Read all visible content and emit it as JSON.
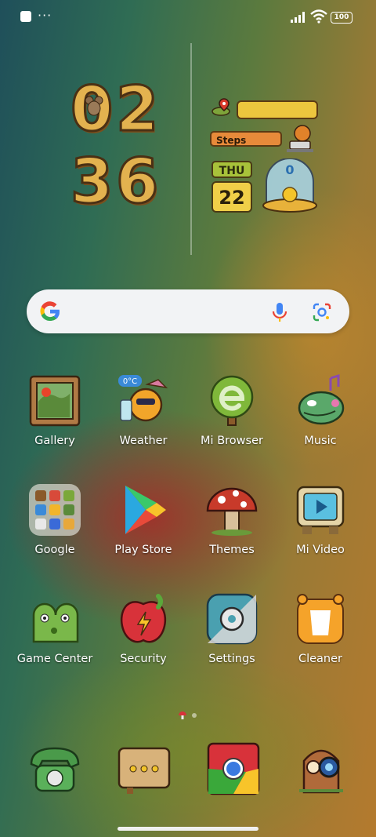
{
  "status_bar": {
    "battery": "100",
    "overflow": "···",
    "icons": [
      "notification-square-icon",
      "more-dots-icon",
      "signal-icon",
      "wifi-icon",
      "battery-icon"
    ]
  },
  "clock": {
    "h1": "0",
    "h2": "2",
    "m1": "3",
    "m2": "6"
  },
  "info_widget": {
    "steps_label": "Steps",
    "day": "THU",
    "date": "22",
    "temperature": "0"
  },
  "search": {
    "icons": [
      "google-logo-icon",
      "microphone-icon",
      "google-lens-icon"
    ]
  },
  "apps": {
    "row1": [
      {
        "label": "Gallery",
        "icon": "gallery-icon"
      },
      {
        "label": "Weather",
        "icon": "weather-icon",
        "badge": "0°C"
      },
      {
        "label": "Mi Browser",
        "icon": "browser-icon"
      },
      {
        "label": "Music",
        "icon": "music-icon"
      }
    ],
    "row2": [
      {
        "label": "Google",
        "icon": "google-folder-icon"
      },
      {
        "label": "Play Store",
        "icon": "play-store-icon"
      },
      {
        "label": "Themes",
        "icon": "themes-icon"
      },
      {
        "label": "Mi Video",
        "icon": "video-icon"
      }
    ],
    "row3": [
      {
        "label": "Game Center",
        "icon": "game-center-icon"
      },
      {
        "label": "Security",
        "icon": "security-icon"
      },
      {
        "label": "Settings",
        "icon": "settings-icon"
      },
      {
        "label": "Cleaner",
        "icon": "cleaner-icon"
      }
    ]
  },
  "dock": [
    {
      "icon": "phone-icon"
    },
    {
      "icon": "messages-icon"
    },
    {
      "icon": "chrome-icon"
    },
    {
      "icon": "camera-icon"
    }
  ],
  "colors": {
    "accent_wood": "#e3b24f",
    "search_bg": "#f2f3f5",
    "label_text": "#ffffff"
  }
}
